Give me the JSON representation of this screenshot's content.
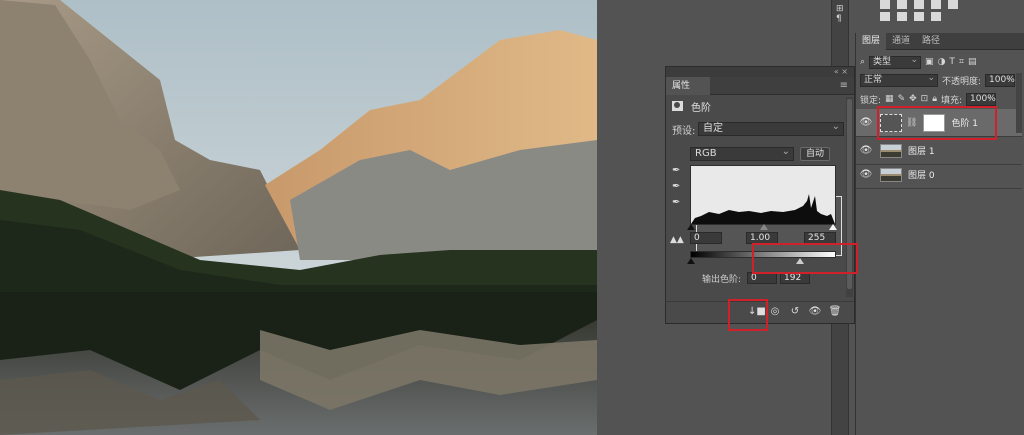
{
  "properties_panel": {
    "tab_label": "属性",
    "header_title": "色阶",
    "preset_label": "预设:",
    "preset_value": "自定",
    "channel_value": "RGB",
    "auto_label": "自动",
    "input_black": "0",
    "input_gamma": "1.00",
    "input_white": "255",
    "output_label": "输出色阶:",
    "output_black": "0",
    "output_white": "192"
  },
  "layers_panel": {
    "tabs": [
      "图层",
      "通道",
      "路径"
    ],
    "filter_kind": "类型",
    "blend_mode": "正常",
    "opacity_label": "不透明度:",
    "opacity_value": "100%",
    "lock_label": "锁定:",
    "fill_label": "填充:",
    "fill_value": "100%",
    "layers": [
      {
        "name": "色阶 1",
        "type": "adjustment"
      },
      {
        "name": "图层 1",
        "type": "image"
      },
      {
        "name": "图层 0",
        "type": "image"
      }
    ]
  },
  "colors": {
    "highlight_box": "#d0202a",
    "panel_bg": "#535353"
  }
}
